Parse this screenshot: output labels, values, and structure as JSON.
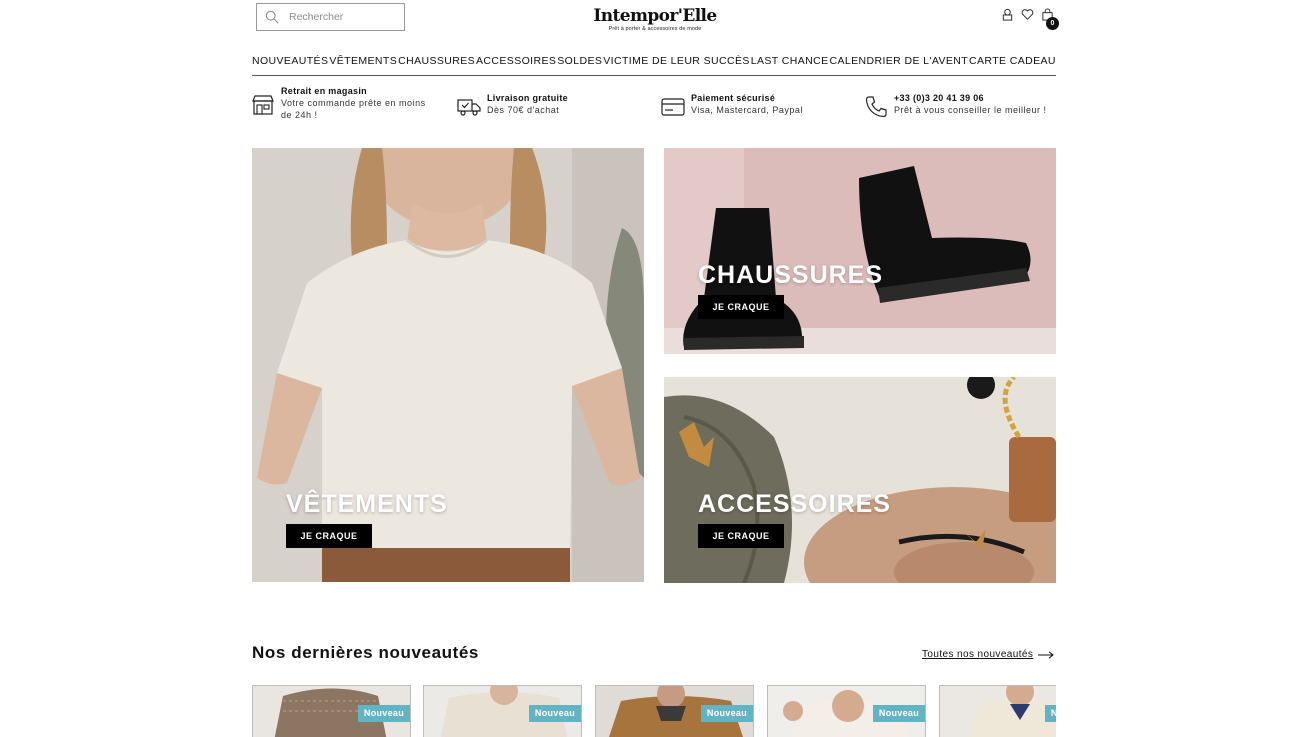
{
  "search": {
    "placeholder": "Rechercher"
  },
  "logo": {
    "name": "Intempor'Elle",
    "tagline": "Prêt à porter & accessoires de mode"
  },
  "cart": {
    "count": "0"
  },
  "nav": [
    "NOUVEAUTÉS",
    "VÊTEMENTS",
    "CHAUSSURES",
    "ACCESSOIRES",
    "SOLDES",
    "VICTIME DE LEUR SUCCÈS",
    "LAST CHANCE",
    "CALENDRIER DE L'AVENT",
    "CARTE CADEAU"
  ],
  "reassurance": [
    {
      "title": "Retrait en magasin",
      "sub1": "Votre commande prête en moins",
      "sub2": "de 24h !",
      "icon": "store-icon"
    },
    {
      "title": "Livraison gratuite",
      "sub1": "Dès 70€ d'achat",
      "icon": "truck-icon"
    },
    {
      "title": "Paiement sécurisé",
      "sub1": "Visa, Mastercard, Paypal",
      "icon": "card-icon"
    },
    {
      "title": "+33 (0)3 20 41 39 06",
      "sub1": "Prêt à vous conseiller le meilleur !",
      "icon": "phone-icon"
    }
  ],
  "tiles": {
    "vetements": {
      "title": "VÊTEMENTS",
      "button": "JE CRAQUE"
    },
    "chaussures": {
      "title": "CHAUSSURES",
      "button": "JE CRAQUE"
    },
    "accessoires": {
      "title": "ACCESSOIRES",
      "button": "JE CRAQUE"
    }
  },
  "section": {
    "title": "Nos dernières nouveautés",
    "see_all": "Toutes nos nouveautés"
  },
  "products": [
    {
      "badge": "Nouveau"
    },
    {
      "badge": "Nouveau"
    },
    {
      "badge": "Nouveau"
    },
    {
      "badge": "Nouveau"
    },
    {
      "badge": "Nouveau"
    }
  ],
  "colors": {
    "badge": "#62b4c4",
    "button": "#000000",
    "text": "#111111"
  }
}
